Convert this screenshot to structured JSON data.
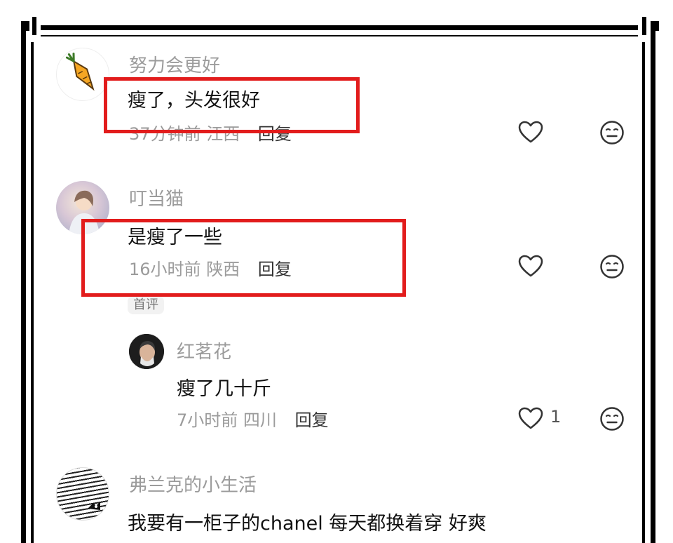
{
  "comments": [
    {
      "author": "努力会更好",
      "text": "瘦了，头发很好",
      "time": "37分钟前",
      "location": "江西",
      "reply_label": "回复",
      "avatar": "carrot-icon"
    },
    {
      "author": "叮当猫",
      "text": "是瘦了一些",
      "time": "16小时前",
      "location": "陕西",
      "reply_label": "回复",
      "tag": "首评",
      "avatar": "photo-avatar"
    },
    {
      "author": "弗兰克的小生活",
      "text": "我要有一柜子的chanel 每天都换着穿 好爽",
      "avatar": "sketch-avatar"
    }
  ],
  "replies": [
    {
      "author": "红茗花",
      "text": "瘦了几十斤",
      "time": "7小时前",
      "location": "四川",
      "reply_label": "回复",
      "like_count": "1",
      "avatar": "portrait-avatar"
    }
  ],
  "icons": {
    "like": "heart-outline-icon",
    "dislike": "meh-face-icon"
  },
  "colors": {
    "highlight_box": "#e21c1c",
    "secondary_text": "#9b9b9b"
  }
}
